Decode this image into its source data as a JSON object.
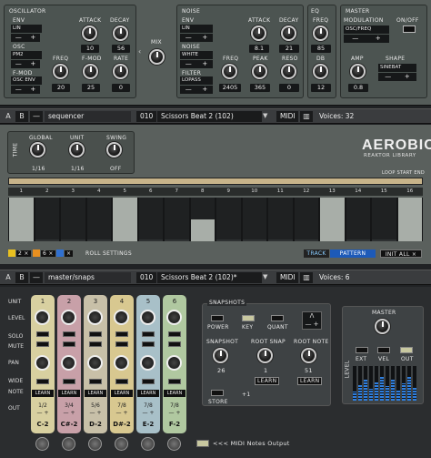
{
  "top": {
    "oscillator": {
      "title": "OSCILLATOR",
      "env_label": "ENV",
      "env_value": "LIN",
      "osc_label": "OSC",
      "osc_value": "PM2",
      "fmod_label": "F-MOD",
      "fmod_value": "OSC ENV",
      "attack_label": "ATTACK",
      "attack_value": "10",
      "decay_label": "DECAY",
      "decay_value": "56",
      "freq_label": "FREQ",
      "freq_value": "20",
      "fmod_knob_label": "F-MOD",
      "fmod_knob_value": "25",
      "rate_label": "RATE",
      "rate_value": "0"
    },
    "mix_label": "MIX",
    "noise": {
      "title": "NOISE",
      "env_label": "ENV",
      "env_value": "LIN",
      "noise_label": "NOISE",
      "noise_value": "WHITE",
      "filter_label": "FILTER",
      "filter_value": "LOPASS",
      "attack_label": "ATTACK",
      "attack_value": "8.1",
      "decay_label": "DECAY",
      "decay_value": "21",
      "freq_label": "FREQ",
      "freq_value": "2405",
      "peak_label": "PEAK",
      "peak_value": "365",
      "reso_label": "RESO",
      "reso_value": "0"
    },
    "eq": {
      "title": "EQ",
      "freq_label": "FREQ",
      "freq_value": "85",
      "db_label": "DB",
      "db_value": "12"
    },
    "master": {
      "title": "MASTER",
      "onoff_label": "ON/OFF",
      "modulation_label": "MODULATION",
      "modulation_value": "OSC/FREQ",
      "amp_label": "AMP",
      "amp_value": "0.8",
      "shape_label": "SHAPE",
      "shape_value": "SINEBAT"
    }
  },
  "bar1": {
    "a": "A",
    "b": "B",
    "minus": "—",
    "name": "sequencer",
    "preset_num": "010",
    "preset": "Scissors Beat 2 (102)",
    "midi": "MIDI",
    "voices": "Voices: 32"
  },
  "sequencer": {
    "time_label": "TIME",
    "global_label": "GLOBAL",
    "global_value": "1/16",
    "unit_label": "UNIT",
    "unit_value": "1/16",
    "swing_label": "SWING",
    "swing_value": "OFF",
    "logo": "AEROBIC",
    "logo_sub": "REAKTOR LIBRARY",
    "loop_label": "LOOP START END",
    "steps": [
      "1",
      "2",
      "3",
      "4",
      "5",
      "6",
      "7",
      "8",
      "9",
      "10",
      "11",
      "12",
      "13",
      "14",
      "15",
      "16"
    ],
    "step_levels": [
      1,
      0.05,
      0.05,
      0.05,
      1,
      0.05,
      0.05,
      0.5,
      0.05,
      0.05,
      0.05,
      0.05,
      1,
      0.05,
      0.05,
      1
    ],
    "roll_settings": "ROLL SETTINGS",
    "chip1": "2 ×",
    "chip2": "6 ×",
    "chip3": "×",
    "track": "TRACK",
    "pattern": "PATTERN",
    "init_all": "INIT ALL ×"
  },
  "bar2": {
    "a": "A",
    "b": "B",
    "minus": "—",
    "name": "master/snaps",
    "preset_num": "010",
    "preset": "Scissors Beat 2 (102)*",
    "midi": "MIDI",
    "voices": "Voices: 6"
  },
  "snaps": {
    "row_labels": [
      "UNIT",
      "LEVEL",
      "SOLO",
      "MUTE",
      "PAN",
      "WIDE",
      "NOTE",
      "OUT"
    ],
    "channels": [
      {
        "num": "1",
        "learn": "LEARN",
        "out": "1/2",
        "note": "C-2",
        "color": "#d8d0a0"
      },
      {
        "num": "2",
        "learn": "LEARN",
        "out": "3/4",
        "note": "C#-2",
        "color": "#c8a0a8"
      },
      {
        "num": "3",
        "learn": "LEARN",
        "out": "5/6",
        "note": "D-2",
        "color": "#c8c0a8"
      },
      {
        "num": "4",
        "learn": "LEARN",
        "out": "7/8",
        "note": "D#-2",
        "color": "#d8c890"
      },
      {
        "num": "5",
        "learn": "LEARN",
        "out": "7/8",
        "note": "E-2",
        "color": "#a8c0c8"
      },
      {
        "num": "6",
        "learn": "LEARN",
        "out": "7/8",
        "note": "F-2",
        "color": "#b0c8a0"
      }
    ],
    "snapshots_title": "SNAPSHOTS",
    "power_label": "POWER",
    "key_label": "KEY",
    "quant_label": "QUANT",
    "snapshot_label": "SNAPSHOT",
    "snapshot_value": "26",
    "root_snap_label": "ROOT SNAP",
    "root_snap_value": "1",
    "root_note_label": "ROOT NOTE",
    "root_note_value": "51",
    "learn": "LEARN",
    "store_label": "STORE",
    "plus1": "+1",
    "master_label": "MASTER",
    "ext_label": "EXT",
    "vel_label": "VEL",
    "out_label": "OUT",
    "level_label": "LEVEL",
    "midi_out": "<<< MIDI Notes Output"
  }
}
